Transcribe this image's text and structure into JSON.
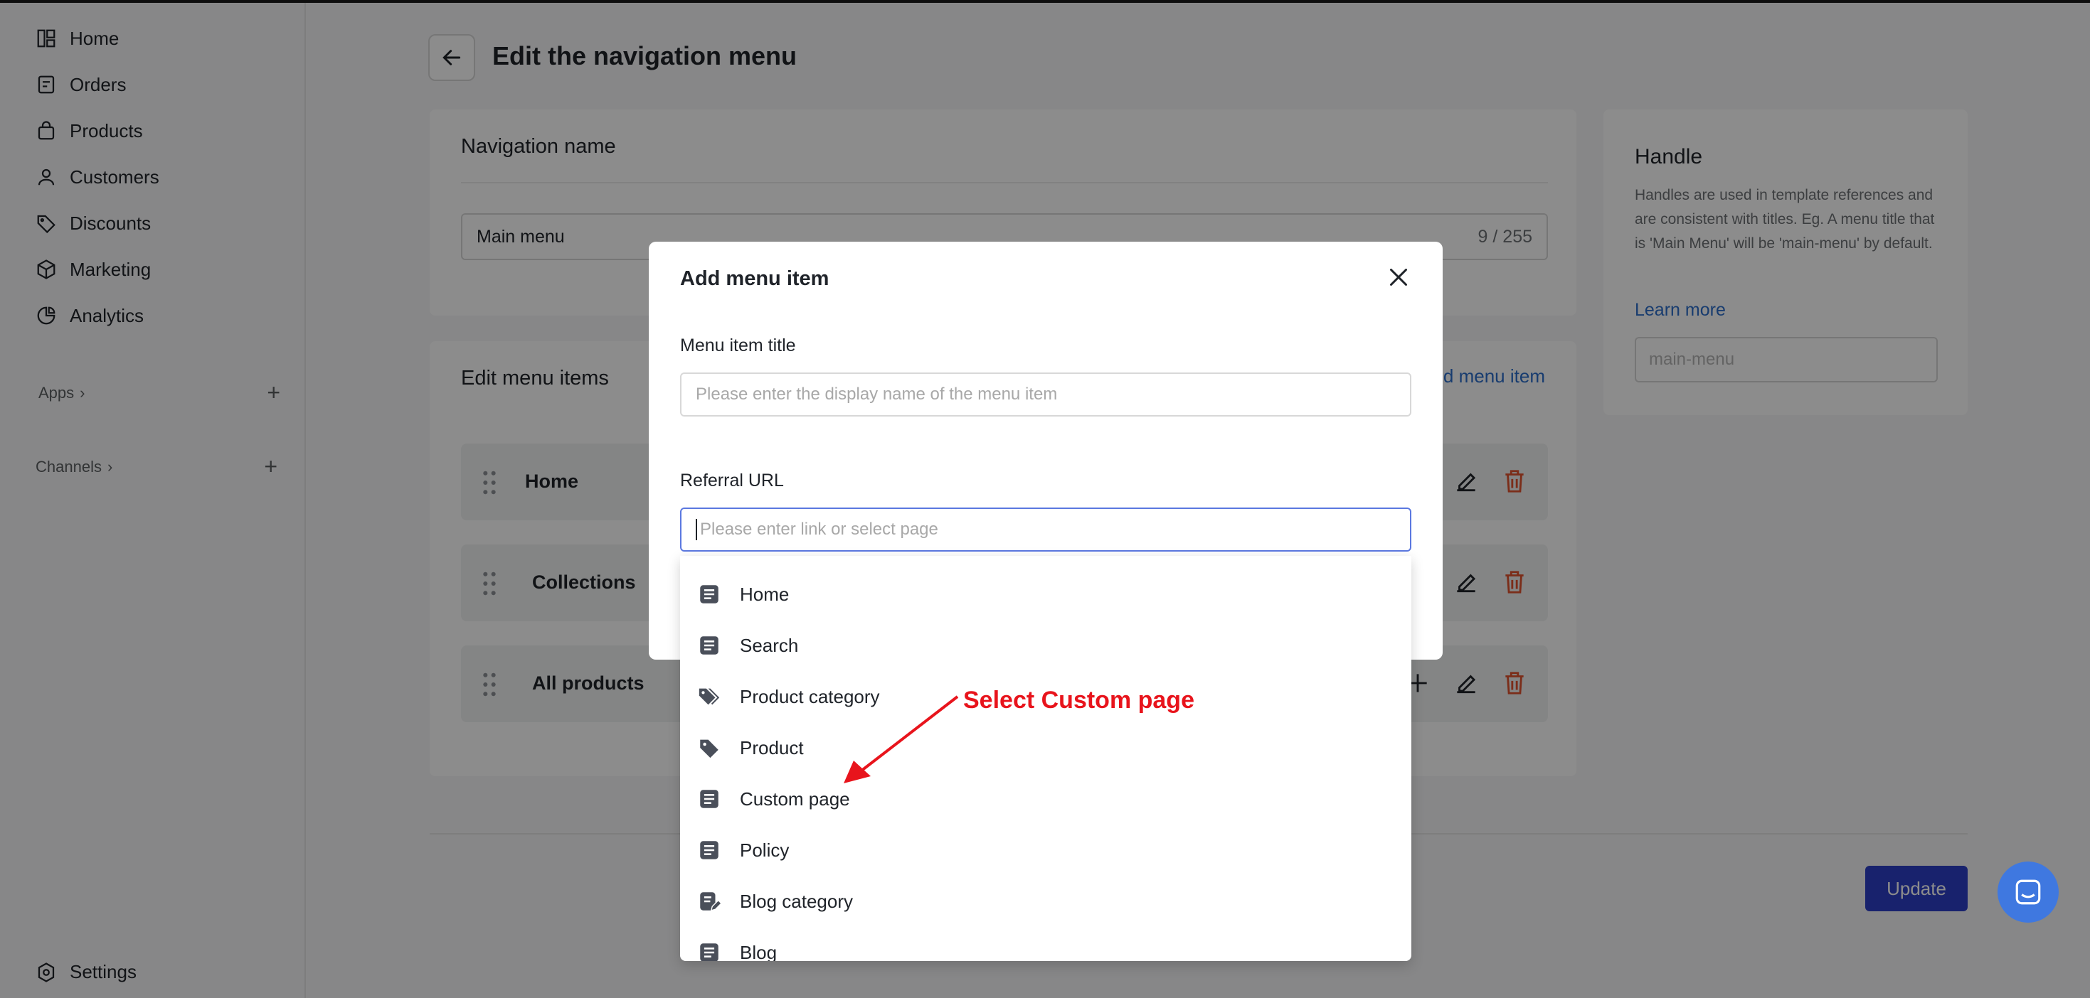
{
  "sidebar": {
    "items": [
      {
        "label": "Home",
        "icon": "dashboard-icon"
      },
      {
        "label": "Orders",
        "icon": "orders-icon"
      },
      {
        "label": "Products",
        "icon": "bag-icon"
      },
      {
        "label": "Customers",
        "icon": "person-icon"
      },
      {
        "label": "Discounts",
        "icon": "tag-icon"
      },
      {
        "label": "Marketing",
        "icon": "cube-icon"
      },
      {
        "label": "Analytics",
        "icon": "pie-chart-icon"
      }
    ],
    "apps_label": "Apps",
    "channels_label": "Channels",
    "settings_label": "Settings"
  },
  "header": {
    "title": "Edit the navigation menu"
  },
  "navigation_card": {
    "title": "Navigation name",
    "value": "Main menu",
    "counter": "9 / 255"
  },
  "items_card": {
    "title": "Edit menu items",
    "add_link": "d menu item",
    "rows": [
      {
        "label": "Home"
      },
      {
        "label": "Collections"
      },
      {
        "label": "All products"
      }
    ]
  },
  "handle_card": {
    "title": "Handle",
    "description": "Handles are used in template references and are consistent with titles. Eg. A menu title that is 'Main Menu' will be 'main-menu' by default.",
    "learn_more": "Learn more",
    "placeholder": "main-menu"
  },
  "footer": {
    "update_label": "Update"
  },
  "modal": {
    "title": "Add menu item",
    "title_label": "Menu item title",
    "title_placeholder": "Please enter the display name of the menu item",
    "url_label": "Referral URL",
    "url_placeholder": "Please enter link or select page"
  },
  "dropdown": {
    "options": [
      {
        "label": "Home",
        "icon": "page-icon"
      },
      {
        "label": "Search",
        "icon": "page-icon"
      },
      {
        "label": "Product category",
        "icon": "tags-icon"
      },
      {
        "label": "Product",
        "icon": "tag-icon"
      },
      {
        "label": "Custom page",
        "icon": "page-icon"
      },
      {
        "label": "Policy",
        "icon": "page-icon"
      },
      {
        "label": "Blog category",
        "icon": "page-edit-icon"
      },
      {
        "label": "Blog",
        "icon": "page-icon"
      }
    ]
  },
  "annotation": {
    "text": "Select Custom page",
    "color": "#e8141c"
  },
  "colors": {
    "primary": "#2c3fc7",
    "link": "#2c6ecb",
    "delete": "#e0522e",
    "chat": "#3f78e0"
  }
}
